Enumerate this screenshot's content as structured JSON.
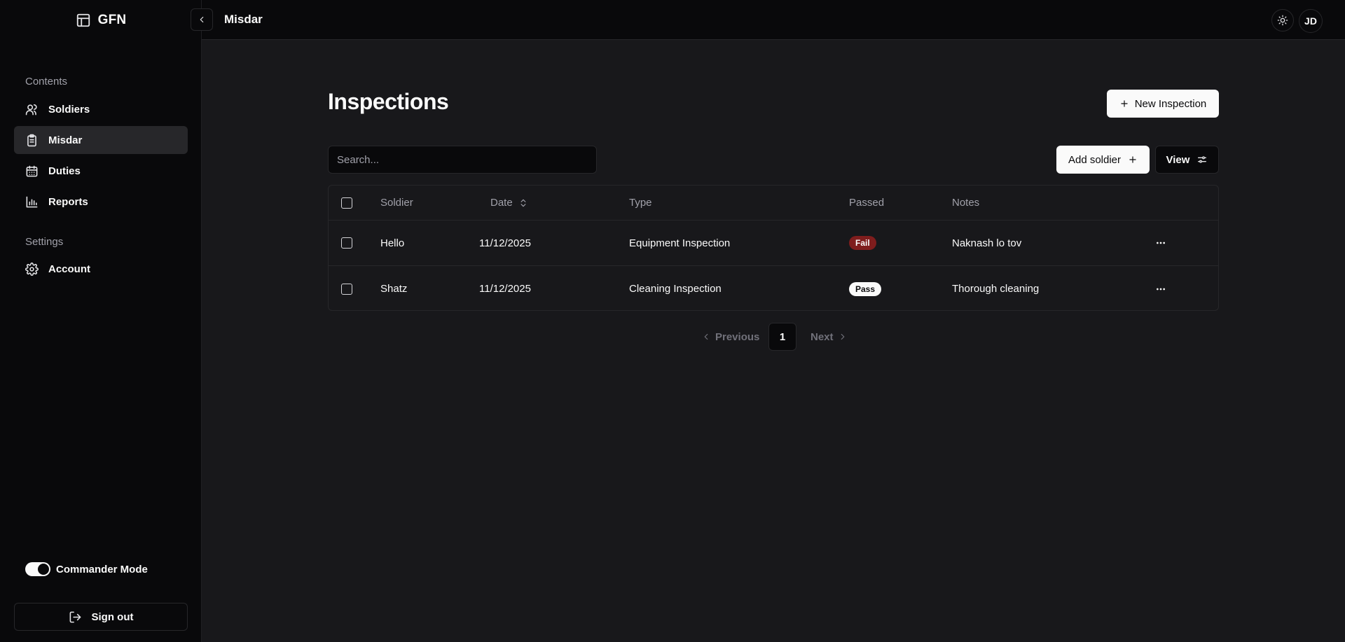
{
  "brand": {
    "name": "GFN",
    "icon": "layout-panel-icon"
  },
  "sidebar": {
    "groups": [
      {
        "label": "Contents"
      },
      {
        "label": "Settings"
      }
    ],
    "items": [
      {
        "label": "Soldiers",
        "icon": "users-icon"
      },
      {
        "label": "Misdar",
        "icon": "clipboard-icon",
        "active": true
      },
      {
        "label": "Duties",
        "icon": "calendar-icon"
      },
      {
        "label": "Reports",
        "icon": "bar-chart-icon"
      },
      {
        "label": "Account",
        "icon": "gear-icon"
      }
    ],
    "commander_mode": {
      "label": "Commander Mode",
      "enabled": true
    },
    "signout_label": "Sign out"
  },
  "topbar": {
    "title": "Misdar",
    "avatar": "JD",
    "theme_icon": "sun-icon"
  },
  "main": {
    "title": "Inspections",
    "new_button": "New Inspection",
    "search_placeholder": "Search...",
    "add_soldier_button": "Add soldier",
    "view_button": "View",
    "columns": [
      "Soldier",
      "Date",
      "Type",
      "Passed",
      "Notes"
    ],
    "rows": [
      {
        "soldier": "Hello",
        "date": "11/12/2025",
        "type": "Equipment Inspection",
        "passed": "Fail",
        "notes": "Naknash lo tov"
      },
      {
        "soldier": "Shatz",
        "date": "11/12/2025",
        "type": "Cleaning Inspection",
        "passed": "Pass",
        "notes": "Thorough cleaning"
      }
    ],
    "pagination": {
      "previous": "Previous",
      "current": "1",
      "next": "Next"
    }
  },
  "colors": {
    "background": "#18181b",
    "sidebar": "#09090b",
    "fail": "#7f1d1d",
    "accent": "#fafafa"
  }
}
